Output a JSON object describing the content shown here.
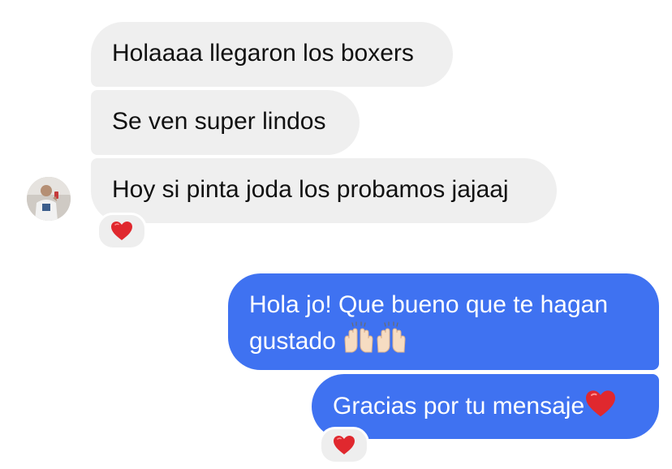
{
  "messages": {
    "incoming": [
      {
        "text": "Holaaaa llegaron los boxers"
      },
      {
        "text": "Se ven super lindos"
      },
      {
        "text": "Hoy si pinta joda los probamos jajaaj",
        "reaction": "red-heart"
      }
    ],
    "outgoing": [
      {
        "text": "Hola jo! Que bueno que te hagan gustado",
        "trailing_emoji": [
          "raising-hands",
          "raising-hands"
        ]
      },
      {
        "text": "Gracias por tu mensaje",
        "trailing_emoji": [
          "red-heart"
        ],
        "reaction": "red-heart"
      }
    ]
  },
  "colors": {
    "incoming_bubble": "#efefef",
    "outgoing_bubble": "#3f72f1",
    "heart": "#e0282e"
  }
}
